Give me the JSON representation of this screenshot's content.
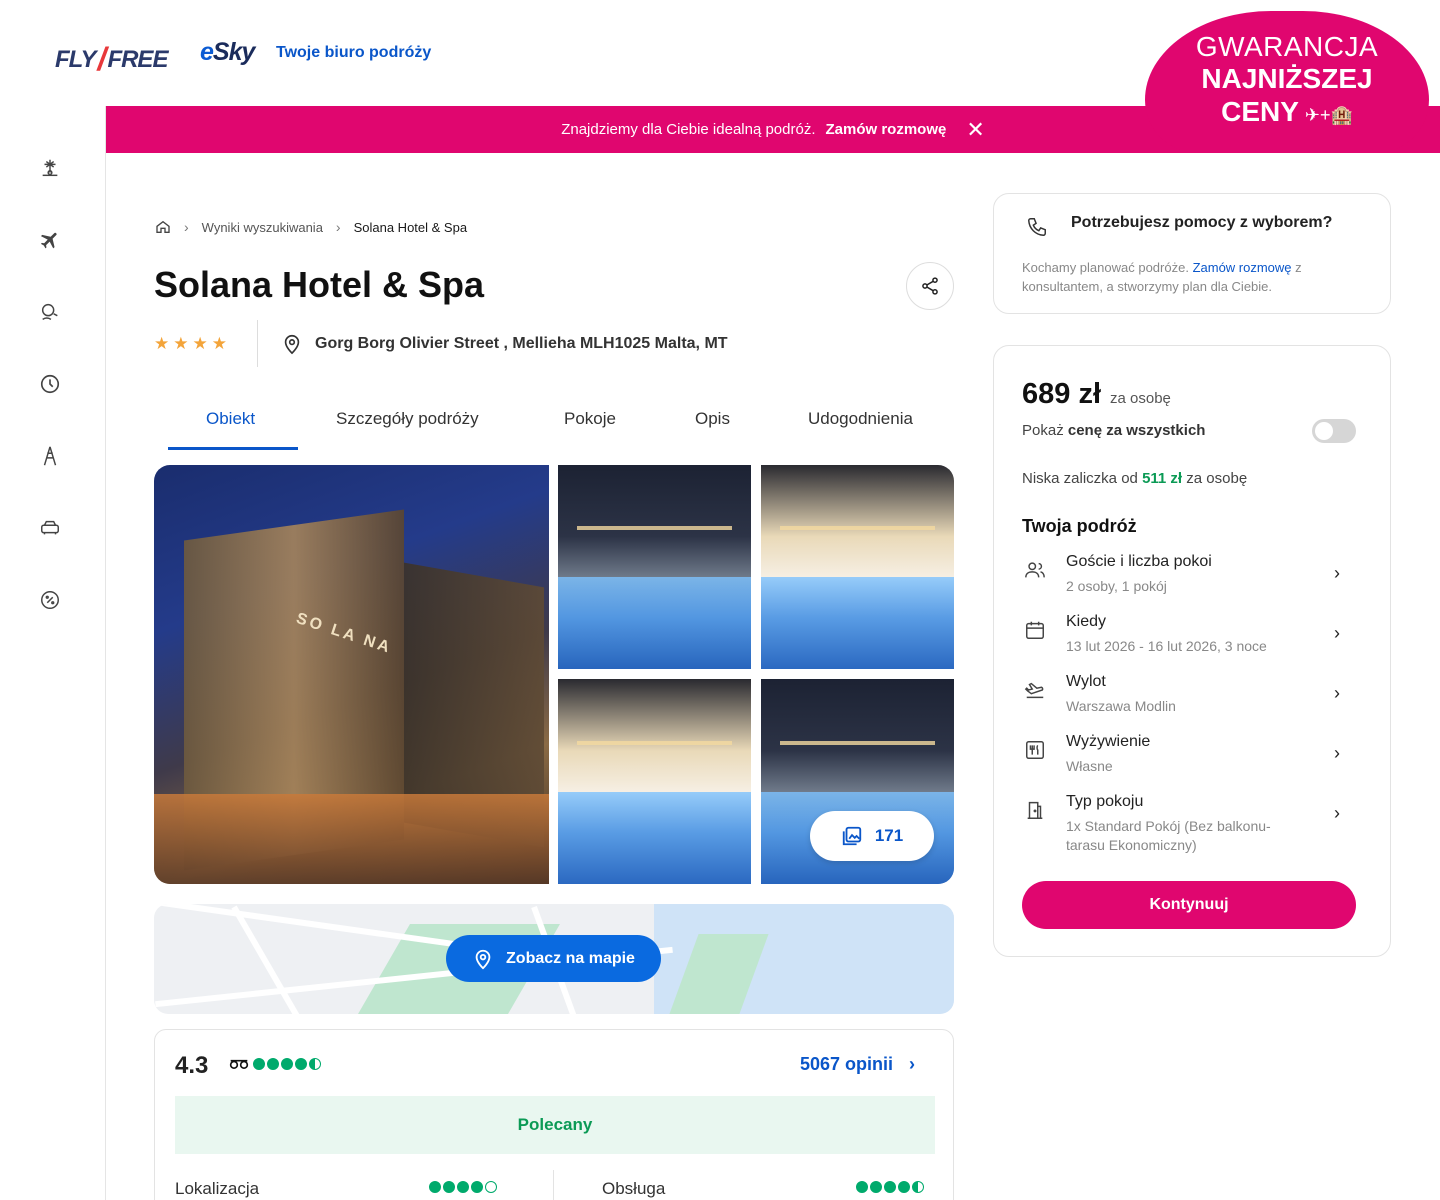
{
  "header": {
    "logo_fly": "FLY",
    "logo_free": "FREE",
    "logo_esky_e": "e",
    "logo_esky_rest": "Sky",
    "tagline": "Twoje biuro podróży",
    "badge": {
      "line1": "GWARANCJA",
      "line2": "NAJNIŻSZEJ",
      "line3": "CENY",
      "line3_icon": "✈+🏨"
    }
  },
  "promo": {
    "text": "Znajdziemy dla Ciebie idealną podróż.",
    "cta": "Zamów rozmowę",
    "close": "✕"
  },
  "sidebar": {
    "items": [
      {
        "icon": "beach-holiday-icon"
      },
      {
        "icon": "plane-icon"
      },
      {
        "icon": "last-minute-icon"
      },
      {
        "icon": "clock-icon"
      },
      {
        "icon": "city-break-icon"
      },
      {
        "icon": "car-icon"
      },
      {
        "icon": "discount-icon"
      }
    ]
  },
  "breadcrumb": {
    "home_icon": "home-icon",
    "items": [
      "Wyniki wyszukiwania",
      "Solana Hotel & Spa"
    ],
    "separator": "›"
  },
  "hotel": {
    "name": "Solana Hotel & Spa",
    "stars": "★★★★",
    "star_count": 4,
    "address": "Gorg Borg Olivier Street , Mellieha MLH1025 Malta, MT"
  },
  "tabs": [
    "Obiekt",
    "Szczegóły podróży",
    "Pokoje",
    "Opis",
    "Udogodnienia"
  ],
  "gallery": {
    "sign_text": "SO LA NA",
    "photo_count": "171"
  },
  "map": {
    "button": "Zobacz na mapie"
  },
  "reviews": {
    "score": "4.3",
    "score_dots": 4.5,
    "count_label": "5067 opinii",
    "recommended": "Polecany",
    "categories": [
      {
        "label": "Lokalizacja",
        "dots": 4
      },
      {
        "label": "Obsługa",
        "dots": 4.5
      }
    ]
  },
  "help": {
    "title": "Potrzebujesz pomocy z wyborem?",
    "body_before": "Kochamy planować podróże.",
    "body_link": "Zamów rozmowę",
    "body_after": "z konsultantem, a stworzymy plan dla Ciebie."
  },
  "booking": {
    "price": "689 zł",
    "price_per": "za osobę",
    "show_all_prefix": "Pokaż",
    "show_all_bold": "cenę za wszystkich",
    "toggle_on": false,
    "deposit_prefix": "Niska zaliczka od",
    "deposit_amount": "511 zł",
    "deposit_suffix": "za osobę",
    "trip_title": "Twoja podróż",
    "rows": [
      {
        "icon": "guests-icon",
        "label": "Goście i liczba pokoi",
        "value": "2 osoby, 1 pokój"
      },
      {
        "icon": "calendar-icon",
        "label": "Kiedy",
        "value": "13 lut 2026 - 16 lut 2026, 3 noce"
      },
      {
        "icon": "departure-icon",
        "label": "Wylot",
        "value": "Warszawa Modlin"
      },
      {
        "icon": "meal-icon",
        "label": "Wyżywienie",
        "value": "Własne"
      },
      {
        "icon": "room-type-icon",
        "label": "Typ pokoju",
        "value": "1x Standard Pokój (Bez balkonu-tarasu Ekonomiczny)"
      }
    ],
    "continue": "Kontynuuj"
  },
  "colors": {
    "brand_pink": "#e0066f",
    "link_blue": "#0a56c9",
    "rating_green": "#00aa6c"
  }
}
